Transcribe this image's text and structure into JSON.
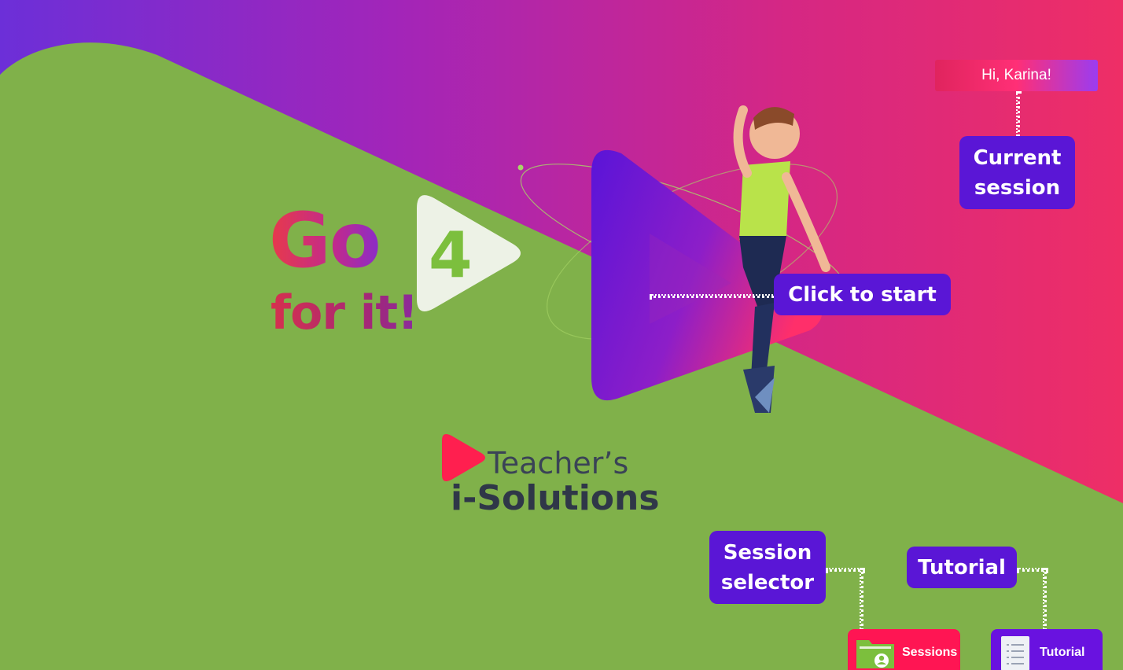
{
  "app": {
    "logo": {
      "word_go": "Go",
      "word_forit": "for it!",
      "level_number": "4"
    },
    "brand": {
      "line1": "Teacher’s",
      "line2": "i-Solutions"
    }
  },
  "header": {
    "greeting": "Hi, Karina!"
  },
  "tooltips": {
    "current_session": [
      "Current",
      "session"
    ],
    "click_to_start": "Click to start",
    "session_selector": [
      "Session",
      "selector"
    ],
    "tutorial": "Tutorial"
  },
  "toolbar": {
    "sessions_label": "Sessions",
    "tutorial_label": "Tutorial"
  },
  "colors": {
    "green_bg": "#80b14a",
    "purple": "#6a1bd6",
    "pink": "#ff1553",
    "tooltip_bg": "#5a16d6"
  },
  "icons": {
    "play_big": "play-icon",
    "sessions": "folder-user-icon",
    "tutorial": "list-icon"
  }
}
